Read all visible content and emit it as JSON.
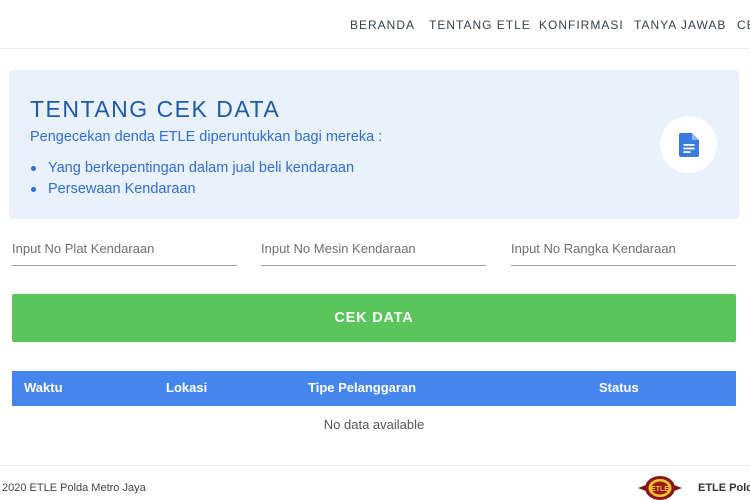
{
  "nav": {
    "items": [
      {
        "label": "BERANDA"
      },
      {
        "label": "TENTANG ETLE"
      },
      {
        "label": "KONFIRMASI"
      },
      {
        "label": "TANYA JAWAB"
      },
      {
        "label": "CE"
      }
    ]
  },
  "info_card": {
    "title": "TENTANG CEK DATA",
    "description": "Pengecekan denda ETLE diperuntukkan bagi mereka :",
    "list": [
      "Yang berkepentingan dalam jual beli kendaraan",
      "Persewaan Kendaraan"
    ],
    "icon": "document-icon",
    "accent_color": "#1e5aa5",
    "text_color": "#2f6fcf",
    "background_color": "#e9f1fd"
  },
  "form": {
    "plat_placeholder": "Input No Plat Kendaraan",
    "mesin_placeholder": "Input No Mesin Kendaraan",
    "rangka_placeholder": "Input No Rangka Kendaraan",
    "submit_label": "CEK DATA",
    "submit_color": "#5ac55a"
  },
  "table": {
    "columns": [
      "Waktu",
      "Lokasi",
      "Tipe Pelanggaran",
      "Status"
    ],
    "empty_text": "No data available",
    "header_color": "#4486ee"
  },
  "footer": {
    "copyright": "2020 ETLE Polda Metro Jaya",
    "logo_text": "ETLE",
    "brand": "ETLE Polda"
  }
}
